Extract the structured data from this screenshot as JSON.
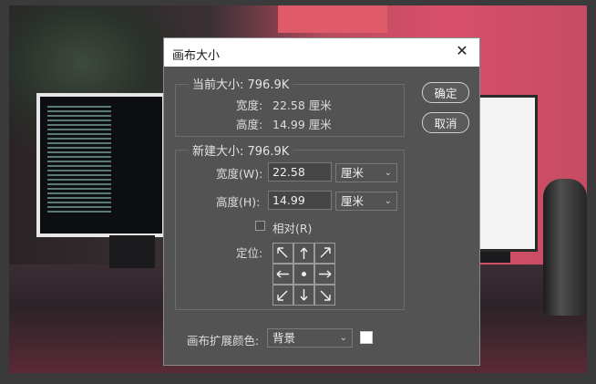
{
  "dialog": {
    "title": "画布大小",
    "close_glyph": "✕",
    "buttons": {
      "ok": "确定",
      "cancel": "取消"
    }
  },
  "current_size": {
    "heading": "当前大小: 796.9K",
    "width_label": "宽度:",
    "width_value": "22.58 厘米",
    "height_label": "高度:",
    "height_value": "14.99 厘米"
  },
  "new_size": {
    "heading": "新建大小: 796.9K",
    "width_label": "宽度(W):",
    "width_value": "22.58",
    "width_unit": "厘米",
    "height_label": "高度(H):",
    "height_value": "14.99",
    "height_unit": "厘米",
    "relative_label": "相对(R)",
    "relative_checked": false,
    "anchor_label": "定位:",
    "anchor_selected": "center"
  },
  "extension": {
    "label": "画布扩展颜色:",
    "value": "背景",
    "swatch_color": "#ffffff"
  },
  "icons": [
    "close-icon",
    "chevron-down-icon",
    "arrow-icon",
    "anchor-dot-icon"
  ]
}
